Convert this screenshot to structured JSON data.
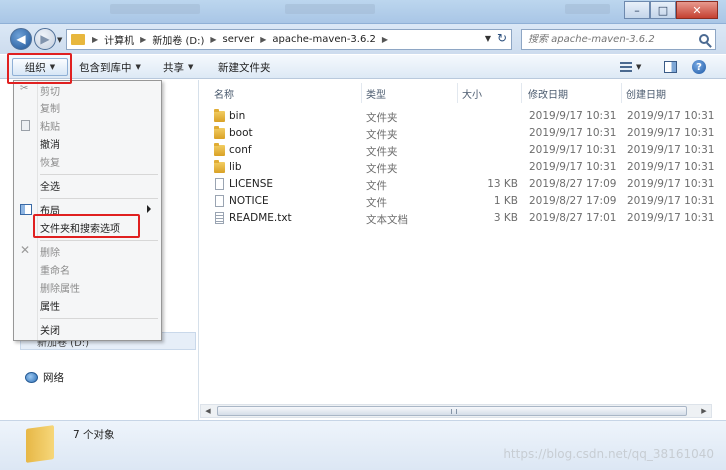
{
  "address": {
    "crumbs": [
      "计算机",
      "新加卷 (D:)",
      "server",
      "apache-maven-3.6.2"
    ],
    "search_placeholder": "搜索 apache-maven-3.6.2"
  },
  "window_buttons": {
    "minimize": "–",
    "maximize": "□",
    "close": "✕"
  },
  "toolbar": {
    "organize": "组织",
    "include_library": "包含到库中",
    "share": "共享",
    "new_folder": "新建文件夹"
  },
  "columns": {
    "name": "名称",
    "type": "类型",
    "size": "大小",
    "modified": "修改日期",
    "created": "创建日期"
  },
  "files": [
    {
      "name": "bin",
      "icon": "folder-icon",
      "type": "文件夹",
      "size": "",
      "modified": "2019/9/17 10:31",
      "created": "2019/9/17 10:31"
    },
    {
      "name": "boot",
      "icon": "folder-icon",
      "type": "文件夹",
      "size": "",
      "modified": "2019/9/17 10:31",
      "created": "2019/9/17 10:31"
    },
    {
      "name": "conf",
      "icon": "folder-icon",
      "type": "文件夹",
      "size": "",
      "modified": "2019/9/17 10:31",
      "created": "2019/9/17 10:31"
    },
    {
      "name": "lib",
      "icon": "folder-icon",
      "type": "文件夹",
      "size": "",
      "modified": "2019/9/17 10:31",
      "created": "2019/9/17 10:31"
    },
    {
      "name": "LICENSE",
      "icon": "file-icon",
      "type": "文件",
      "size": "13 KB",
      "modified": "2019/8/27 17:09",
      "created": "2019/9/17 10:31"
    },
    {
      "name": "NOTICE",
      "icon": "file-icon",
      "type": "文件",
      "size": "1 KB",
      "modified": "2019/8/27 17:09",
      "created": "2019/9/17 10:31"
    },
    {
      "name": "README.txt",
      "icon": "txt-icon",
      "type": "文本文档",
      "size": "3 KB",
      "modified": "2019/8/27 17:01",
      "created": "2019/9/17 10:31"
    }
  ],
  "menu": {
    "cut": "剪切",
    "copy": "复制",
    "paste": "粘贴",
    "undo": "撤消",
    "redo": "恢复",
    "select_all": "全选",
    "layout": "布局",
    "folder_options": "文件夹和搜索选项",
    "delete": "删除",
    "rename": "重命名",
    "remove_props": "删除属性",
    "properties": "属性",
    "close": "关闭"
  },
  "nav": {
    "drive": "新加卷 (D:)",
    "network": "网络"
  },
  "status": {
    "count": "7 个对象"
  },
  "watermark": "https://blog.csdn.net/qq_38161040",
  "colors": {
    "highlight_box": "#e02020",
    "folder": "#e8b73d",
    "chrome": "#cddcee"
  }
}
